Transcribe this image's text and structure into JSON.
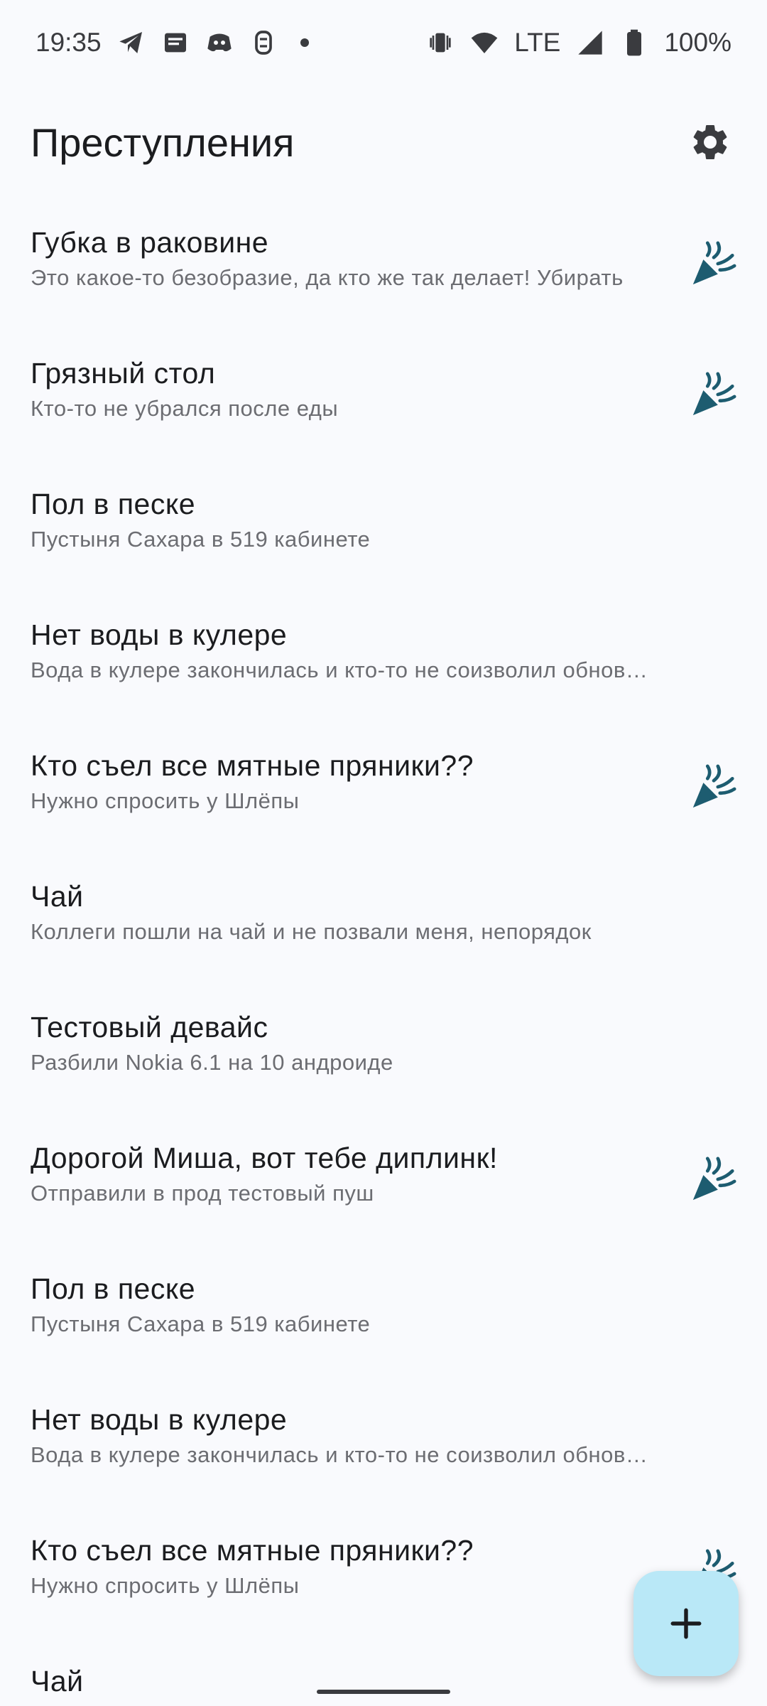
{
  "status_bar": {
    "time": "19:35",
    "network": "LTE",
    "battery": "100%",
    "left_icons": [
      "telegram-icon",
      "news-icon",
      "discord-icon",
      "game-icon"
    ],
    "right_icons": [
      "vibrate-icon",
      "wifi-icon",
      "signal-icon",
      "battery-icon"
    ]
  },
  "app_bar": {
    "title": "Преступления",
    "settings_icon": "gear-icon"
  },
  "crimes": [
    {
      "title": "Губка в раковине",
      "description": "Это какое-то безобразие, да кто же так делает! Убирать",
      "solved": true
    },
    {
      "title": "Грязный стол",
      "description": "Кто-то не убрался после еды",
      "solved": true
    },
    {
      "title": "Пол в песке",
      "description": "Пустыня Сахара в 519 кабинете",
      "solved": false
    },
    {
      "title": "Нет воды в кулере",
      "description": "Вода в кулере закончилась и кто-то не соизволил обновить",
      "solved": false
    },
    {
      "title": "Кто съел все мятные пряники??",
      "description": "Нужно спросить у Шлёпы",
      "solved": true
    },
    {
      "title": "Чай",
      "description": "Коллеги пошли на чай и не позвали меня, непорядок",
      "solved": false
    },
    {
      "title": "Тестовый девайс",
      "description": "Разбили Nokia 6.1 на 10 андроиде",
      "solved": false
    },
    {
      "title": "Дорогой Миша, вот тебе диплинк!",
      "description": "Отправили в прод тестовый пуш",
      "solved": true
    },
    {
      "title": "Пол в песке",
      "description": "Пустыня Сахара в 519 кабинете",
      "solved": false
    },
    {
      "title": "Нет воды в кулере",
      "description": "Вода в кулере закончилась и кто-то не соизволил обновить",
      "solved": false
    },
    {
      "title": "Кто съел все мятные пряники??",
      "description": "Нужно спросить у Шлёпы",
      "solved": true
    },
    {
      "title": "Чай",
      "description": "",
      "solved": false
    }
  ],
  "fab": {
    "icon": "plus-icon"
  },
  "colors": {
    "background": "#f9fafd",
    "accent": "#1d5c70",
    "fab": "#b9e8f7"
  }
}
